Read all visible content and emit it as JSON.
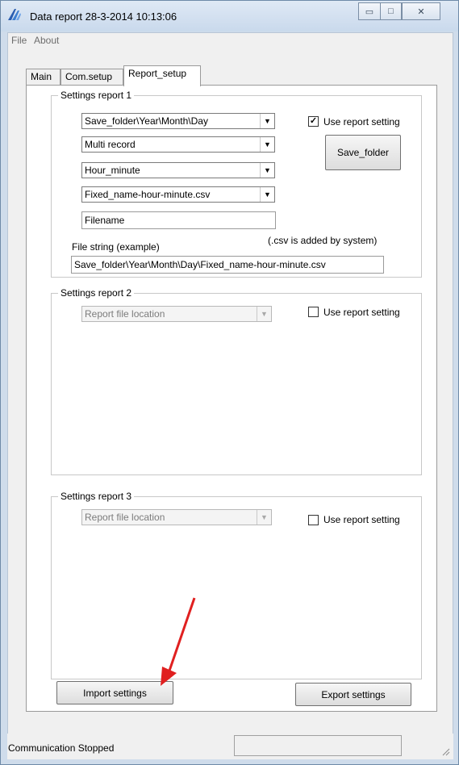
{
  "window": {
    "title": "Data report 28-3-2014 10:13:06",
    "minimize_glyph": "▭",
    "maximize_glyph": "□",
    "close_glyph": "✕"
  },
  "menu": {
    "file": "File",
    "about": "About"
  },
  "tabs": [
    {
      "label": "Main"
    },
    {
      "label": "Com.setup"
    },
    {
      "label": "Report_setup"
    }
  ],
  "report1": {
    "group_label": "Settings report 1",
    "folder_structure": "Save_folder\\Year\\Month\\Day",
    "record_mode": "Multi record",
    "time_format": "Hour_minute",
    "name_format": "Fixed_name-hour-minute.csv",
    "filename_value": "Filename",
    "use_setting_label": "Use report setting",
    "use_setting_checked": "✓",
    "save_folder_button": "Save_folder",
    "csv_note": "(.csv is added by system)",
    "file_string_label": "File string (example)",
    "file_string_value": "Save_folder\\Year\\Month\\Day\\Fixed_name-hour-minute.csv"
  },
  "report2": {
    "group_label": "Settings report 2",
    "location": "Report file location",
    "use_setting_label": "Use report setting"
  },
  "report3": {
    "group_label": "Settings report 3",
    "location": "Report file location",
    "use_setting_label": "Use report setting"
  },
  "buttons": {
    "import": "Import settings",
    "export": "Export settings"
  },
  "status": {
    "text": "Communication Stopped"
  },
  "colors": {
    "frame": "#cfdceb",
    "client": "#f0f0f0",
    "annotation_arrow": "#e02020"
  },
  "icons": [
    "app-logo-icon",
    "dropdown-arrow-icon",
    "resize-grip-icon"
  ]
}
